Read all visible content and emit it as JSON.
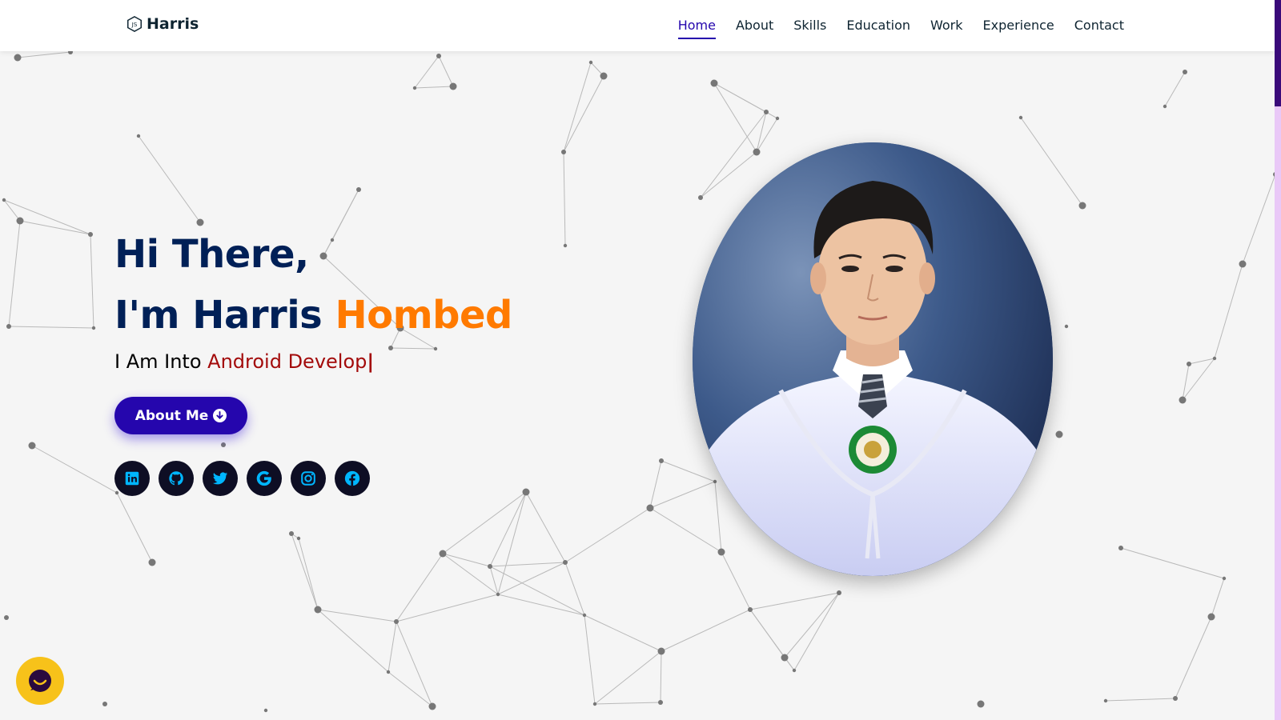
{
  "header": {
    "logo_text": "Harris",
    "nav": [
      {
        "label": "Home",
        "active": true
      },
      {
        "label": "About"
      },
      {
        "label": "Skills"
      },
      {
        "label": "Education"
      },
      {
        "label": "Work"
      },
      {
        "label": "Experience"
      },
      {
        "label": "Contact"
      }
    ]
  },
  "hero": {
    "greeting": "Hi There,",
    "intro_prefix": "I'm Harris",
    "intro_name": "Hombed",
    "typing_prefix": "I Am Into",
    "typing_text": "Android Develop",
    "cursor": "|",
    "about_button": "About Me",
    "socials": [
      "linkedin-icon",
      "github-icon",
      "twitter-icon",
      "google-icon",
      "instagram-icon",
      "facebook-icon"
    ]
  },
  "colors": {
    "primary": "#2506ad",
    "heading": "#002057",
    "accent_orange": "#ff7a00",
    "accent_red": "#a30b0b",
    "social_bg": "#0e0e24",
    "social_icon": "#00b6ff",
    "chat_bg": "#f7c21a"
  },
  "widgets": {
    "chat_icon": "chat-icon"
  }
}
